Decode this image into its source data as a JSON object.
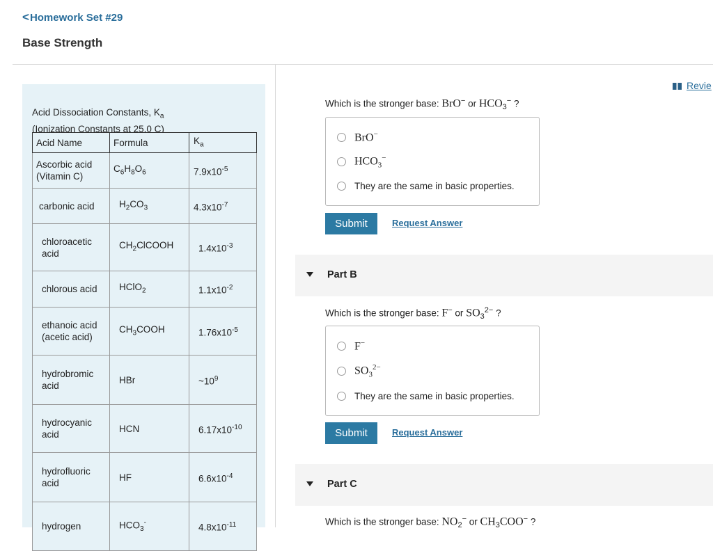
{
  "header": {
    "back_label": "Homework Set #29",
    "page_title": "Base Strength",
    "review_label": "Revie"
  },
  "ka_panel": {
    "title_line1": "Acid Dissociation Constants, K",
    "title_line1_sub": "a",
    "title_line2": "(Ionization Constants at 25.0 C)",
    "headers": {
      "name": "Acid Name",
      "formula": "Formula",
      "ka": "K",
      "ka_sub": "a"
    },
    "rows": [
      {
        "name": "Ascorbic acid (Vitamin C)",
        "formula": [
          [
            "C",
            ""
          ],
          [
            "6",
            "sub"
          ],
          [
            "H",
            ""
          ],
          [
            "8",
            "sub"
          ],
          [
            "O",
            ""
          ],
          [
            "6",
            "sub"
          ]
        ],
        "ka": [
          [
            "7.9x10",
            ""
          ],
          [
            "-5",
            "sup"
          ]
        ]
      },
      {
        "name": "carbonic acid",
        "formula": [
          [
            "H",
            ""
          ],
          [
            "2",
            "sub"
          ],
          [
            "CO",
            ""
          ],
          [
            "3",
            "sub"
          ]
        ],
        "ka": [
          [
            "4.3x10",
            ""
          ],
          [
            "-7",
            "sup"
          ]
        ]
      },
      {
        "name": "chloroacetic acid",
        "formula": [
          [
            "CH",
            ""
          ],
          [
            "2",
            "sub"
          ],
          [
            "ClCOOH",
            ""
          ]
        ],
        "ka": [
          [
            "1.4x10",
            ""
          ],
          [
            "-3",
            "sup"
          ]
        ]
      },
      {
        "name": "chlorous acid",
        "formula": [
          [
            "HClO",
            ""
          ],
          [
            "2",
            "sub"
          ]
        ],
        "ka": [
          [
            "1.1x10",
            ""
          ],
          [
            "-2",
            "sup"
          ]
        ]
      },
      {
        "name": "ethanoic acid (acetic acid)",
        "formula": [
          [
            "CH",
            ""
          ],
          [
            "3",
            "sub"
          ],
          [
            "COOH",
            ""
          ]
        ],
        "ka": [
          [
            "1.76x10",
            ""
          ],
          [
            "-5",
            "sup"
          ]
        ]
      },
      {
        "name": "hydrobromic acid",
        "formula": [
          [
            "HBr",
            ""
          ]
        ],
        "ka": [
          [
            "~10",
            ""
          ],
          [
            "9",
            "sup"
          ]
        ]
      },
      {
        "name": "hydrocyanic acid",
        "formula": [
          [
            "HCN",
            ""
          ]
        ],
        "ka": [
          [
            "6.17x10",
            ""
          ],
          [
            "-10",
            "sup"
          ]
        ]
      },
      {
        "name": "hydrofluoric acid",
        "formula": [
          [
            "HF",
            ""
          ]
        ],
        "ka": [
          [
            "6.6x10",
            ""
          ],
          [
            "-4",
            "sup"
          ]
        ]
      },
      {
        "name": "hydrogen",
        "formula": [
          [
            "HCO",
            ""
          ],
          [
            "3",
            "sub"
          ],
          [
            "-",
            "sup"
          ]
        ],
        "ka": [
          [
            "4.8x10",
            ""
          ],
          [
            "-11",
            "sup"
          ]
        ]
      }
    ]
  },
  "part_a": {
    "question_prefix": "Which is the stronger base: ",
    "q_species1": "BrO",
    "q_species1_sup": "−",
    "q_or": " or ",
    "q_species2": "HCO",
    "q_species2_sub": "3",
    "q_species2_sup": "−",
    "q_end": "?",
    "option1": "BrO",
    "option1_sup": "−",
    "option2": "HCO",
    "option2_sub": "3",
    "option2_sup": "−",
    "option3": "They are the same in basic properties.",
    "submit_label": "Submit",
    "request_label": "Request Answer"
  },
  "part_b": {
    "label": "Part B",
    "question_prefix": "Which is the stronger base: ",
    "q_species1": "F",
    "q_species1_sup": "−",
    "q_or": " or ",
    "q_species2": "SO",
    "q_species2_sub": "3",
    "q_species2_sup": "2−",
    "q_end": "?",
    "option1": "F",
    "option1_sup": "−",
    "option2": "SO",
    "option2_sub": "3",
    "option2_sup": "2−",
    "option3": "They are the same in basic properties.",
    "submit_label": "Submit",
    "request_label": "Request Answer"
  },
  "part_c": {
    "label": "Part C",
    "question_prefix": "Which is the stronger base: ",
    "q_species1": "NO",
    "q_species1_sub": "2",
    "q_species1_sup": "−",
    "q_or": " or ",
    "q_species2": "CH",
    "q_species2_sub": "3",
    "q_species2_rest": "COO",
    "q_species2_sup": "−",
    "q_end": "?"
  }
}
